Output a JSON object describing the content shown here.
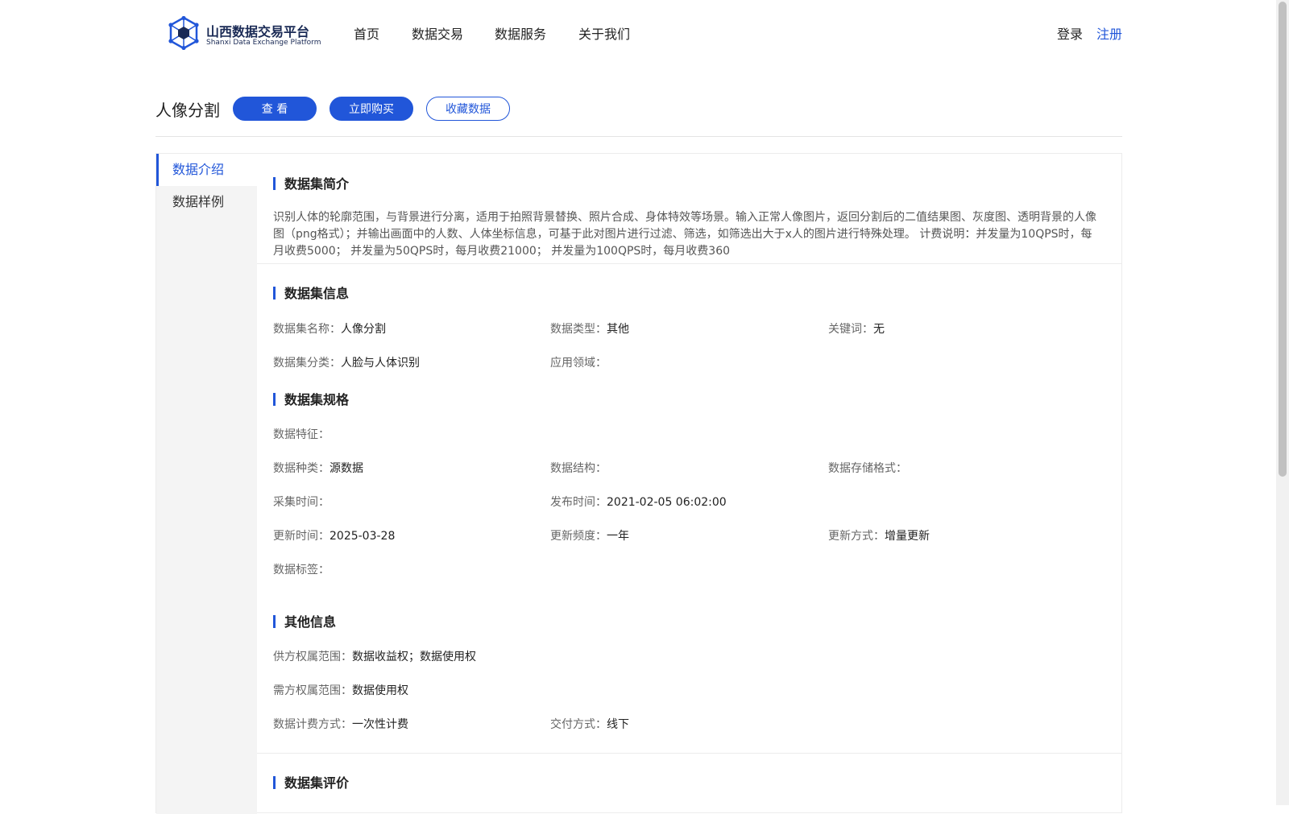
{
  "header": {
    "logo_cn": "山西数据交易平台",
    "logo_en": "Shanxi Data Exchange Platform",
    "nav": [
      "首页",
      "数据交易",
      "数据服务",
      "关于我们"
    ],
    "login": "登录",
    "register": "注册"
  },
  "product": {
    "title": "人像分割",
    "view_button": "查 看",
    "buy_button": "立即购买",
    "favorite_button": "收藏数据"
  },
  "sidebar": {
    "items": [
      {
        "label": "数据介绍",
        "active": true
      },
      {
        "label": "数据样例",
        "active": false
      }
    ]
  },
  "sections": {
    "intro_title": "数据集简介",
    "intro_text": "识别人体的轮廓范围，与背景进行分离，适用于拍照背景替换、照片合成、身体特效等场景。输入正常人像图片，返回分割后的二值结果图、灰度图、透明背景的人像图（png格式）；并输出画面中的人数、人体坐标信息，可基于此对图片进行过滤、筛选，如筛选出大于x人的图片进行特殊处理。 计费说明：并发量为10QPS时，每月收费5000； 并发量为50QPS时，每月收费21000； 并发量为100QPS时，每月收费360",
    "info_title": "数据集信息",
    "spec_title": "数据集规格",
    "other_title": "其他信息",
    "rating_title": "数据集评价"
  },
  "info": {
    "name_label": "数据集名称：",
    "name_value": "人像分割",
    "type_label": "数据类型：",
    "type_value": "其他",
    "keyword_label": "关键词：",
    "keyword_value": "无",
    "category_label": "数据集分类：",
    "category_value": "人脸与人体识别",
    "domain_label": "应用领域：",
    "domain_value": ""
  },
  "spec": {
    "feature_label": "数据特征：",
    "feature_value": "",
    "kind_label": "数据种类：",
    "kind_value": "源数据",
    "structure_label": "数据结构：",
    "structure_value": "",
    "storage_label": "数据存储格式：",
    "storage_value": "",
    "collect_label": "采集时间：",
    "collect_value": "",
    "publish_label": "发布时间：",
    "publish_value": "2021-02-05 06:02:00",
    "update_label": "更新时间：",
    "update_value": "2025-03-28",
    "frequency_label": "更新频度：",
    "frequency_value": "一年",
    "method_label": "更新方式：",
    "method_value": "增量更新",
    "tag_label": "数据标签：",
    "tag_value": ""
  },
  "other": {
    "supply_label": "供方权属范围：",
    "supply_value": "数据收益权；数据使用权",
    "demand_label": "需方权属范围：",
    "demand_value": "数据使用权",
    "billing_label": "数据计费方式：",
    "billing_value": "一次性计费",
    "delivery_label": "交付方式：",
    "delivery_value": "线下"
  },
  "colors": {
    "accent": "#2156d9",
    "brand_dark": "#1a2a55"
  }
}
